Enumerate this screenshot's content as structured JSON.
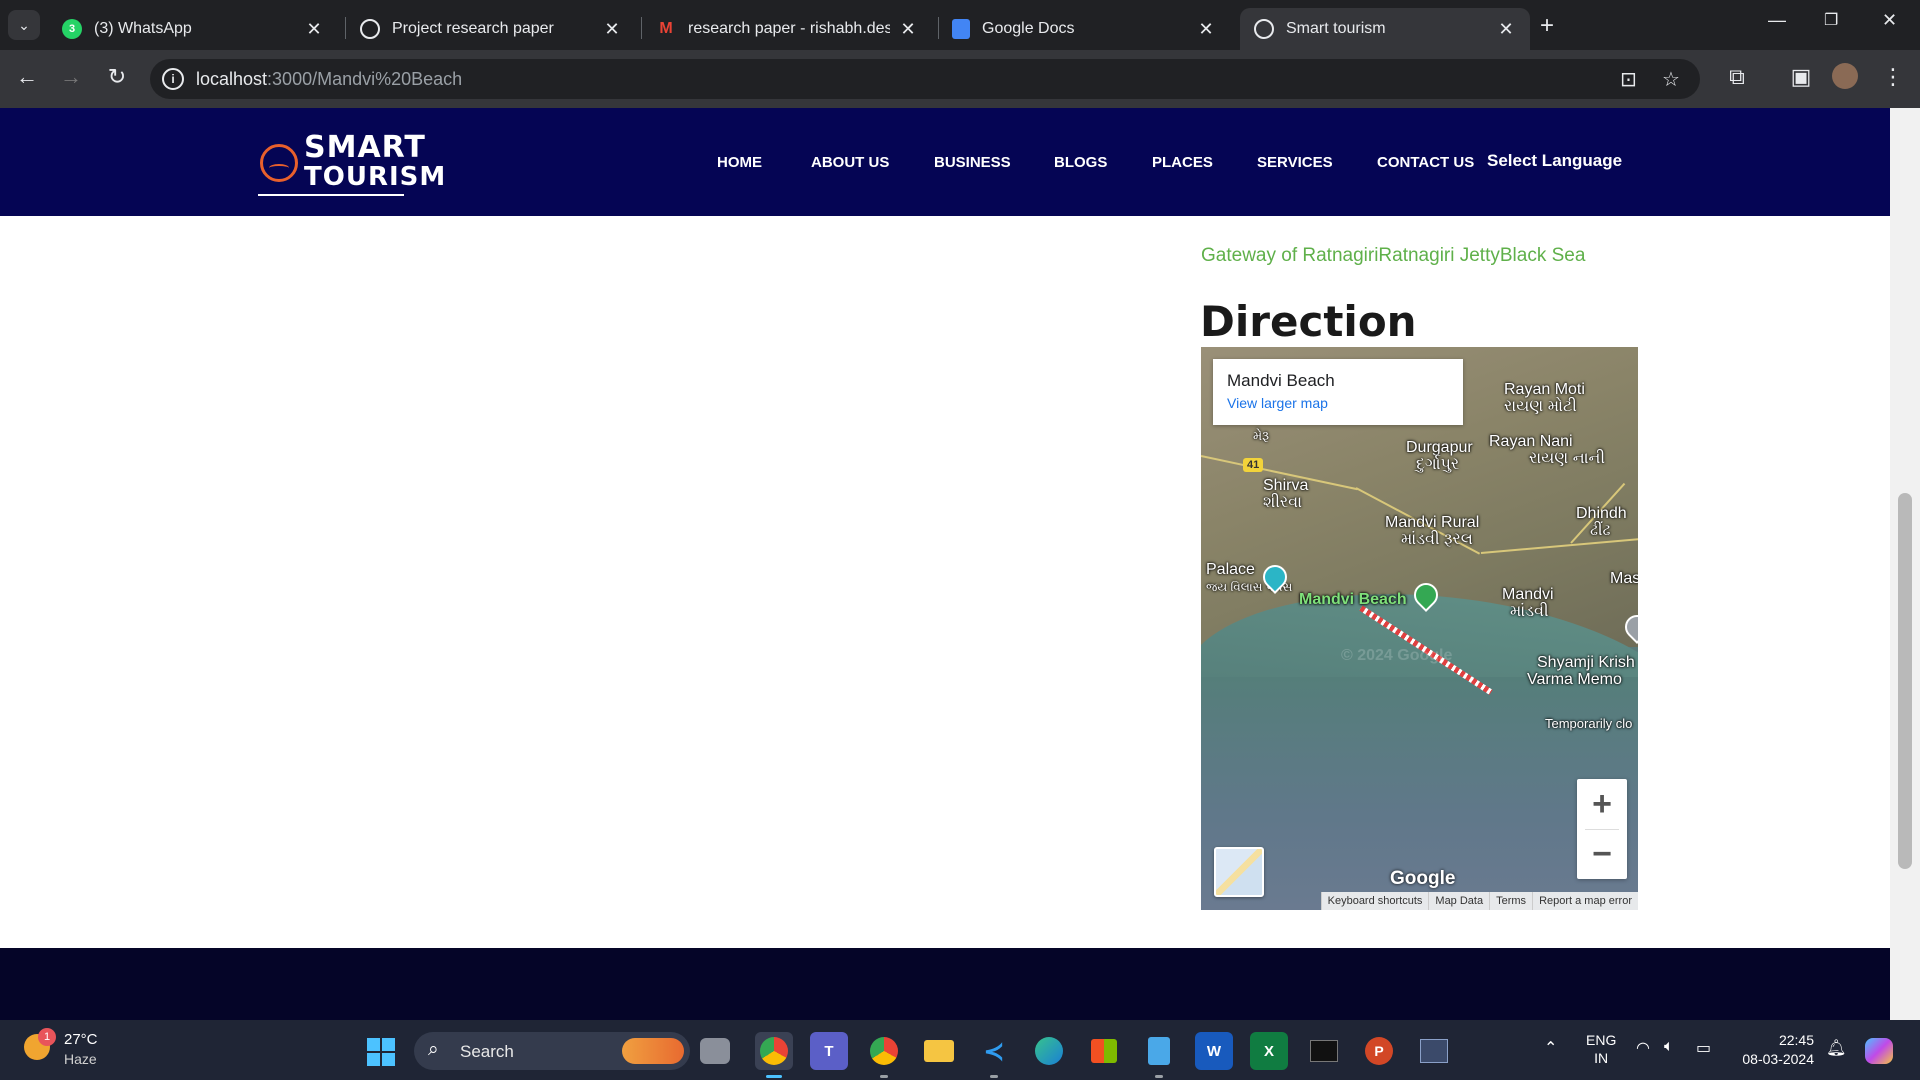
{
  "browser": {
    "tabs": [
      {
        "title": "(3) WhatsApp",
        "icon": "whatsapp-icon"
      },
      {
        "title": "Project research paper",
        "icon": "globe-icon"
      },
      {
        "title": "research paper - rishabh.desai@",
        "icon": "gmail-icon"
      },
      {
        "title": "Google Docs",
        "icon": "docs-icon"
      },
      {
        "title": "Smart tourism",
        "icon": "globe-icon",
        "active": true
      }
    ],
    "url_host": "localhost",
    "url_path": ":3000/Mandvi%20Beach"
  },
  "site": {
    "logo_line1": "SMART",
    "logo_line2": "TOURISM",
    "nav": [
      "HOME",
      "ABOUT US",
      "BUSINESS",
      "BLOGS",
      "PLACES",
      "SERVICES",
      "CONTACT US"
    ],
    "language": "Select Language"
  },
  "content": {
    "tags": "Gateway of RatnagiriRatnagiri JettyBlack Sea",
    "direction_heading": "Direction"
  },
  "map": {
    "place_name": "Mandvi Beach",
    "view_larger": "View larger map",
    "route_number": "41",
    "labels": {
      "rayan_moti": "Rayan Moti",
      "rayan_moti_gu": "રાયણ મોટી",
      "rayan_nani": "Rayan Nani",
      "rayan_nani_gu": "રાયણ નાની",
      "durgapur": "Durgapur",
      "durgapur_gu": "દુર્ગાપુર",
      "merau_gu": "મેરૂ",
      "shirva": "Shirva",
      "shirva_gu": "શીરવા",
      "dhindh": "Dhindh",
      "dhindh_gu": "ઢીંઢ",
      "mandvi_rural": "Mandvi Rural",
      "mandvi_rural_gu": "માંડવી રૂરલ",
      "palace": "Palace",
      "palace_gu": "જય વિલાસ પેલેસ",
      "mandvi_beach": "Mandvi Beach",
      "mandvi": "Mandvi",
      "mandvi_gu": "માંડવી",
      "mas": "Mas",
      "shyamji": "Shyamji Krish",
      "varma": "Varma Memo",
      "temporarily": "Temporarily clo"
    },
    "google": "Google",
    "watermark": "© 2024 Google",
    "attribution": [
      "Keyboard shortcuts",
      "Map Data",
      "Terms",
      "Report a map error"
    ]
  },
  "taskbar": {
    "weather_badge": "1",
    "temperature": "27°C",
    "condition": "Haze",
    "search_label": "Search",
    "lang_line1": "ENG",
    "lang_line2": "IN",
    "time": "22:45",
    "date": "08-03-2024"
  },
  "colors": {
    "site_header": "#050554",
    "tag_green": "#5fb04a",
    "footer": "#050528",
    "logo_accent": "#e8602c"
  }
}
